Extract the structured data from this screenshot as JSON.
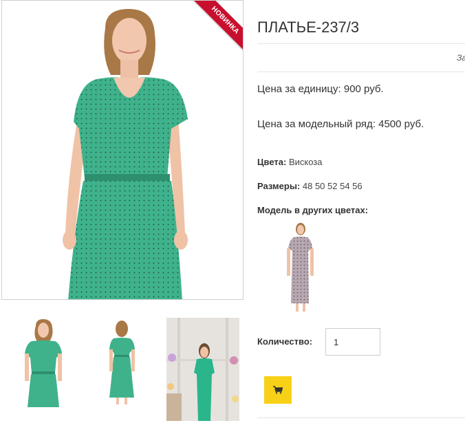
{
  "product": {
    "title": "ПЛАТЬЕ-237/3",
    "badge": "НОВИНКА",
    "truncated_text": "За",
    "price_unit": "Цена за единицу: 900 руб.",
    "price_series": "Цена за модельный ряд: 4500 руб.",
    "colors_label": "Цвета:",
    "colors_value": "Вискоза",
    "sizes_label": "Размеры:",
    "sizes_value": "48 50 52 54 56",
    "other_colors_label": "Модель в других цветах:",
    "quantity_label": "Количество:",
    "quantity_value": "1"
  },
  "colors": {
    "dress_main": "#3fb28c",
    "dress_variant": "#b7a7b0",
    "badge": "#c8102e",
    "cart_button": "#f7d117",
    "divider": "#e3e3e3"
  },
  "icons": {
    "cart": "cart-icon"
  }
}
